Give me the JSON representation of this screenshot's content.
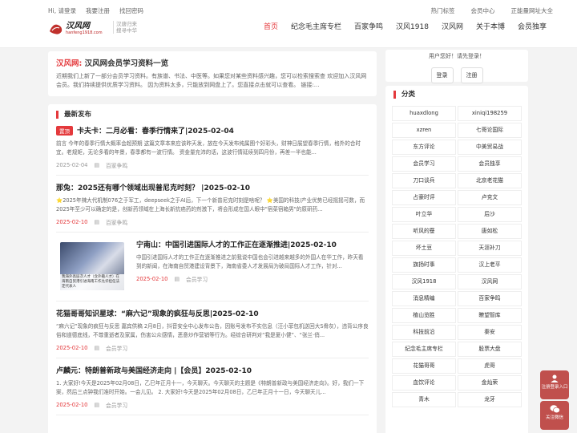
{
  "topbar": {
    "left": [
      "Hi, 请登录",
      "我要注册",
      "找回密码"
    ],
    "right": [
      "热门标签",
      "会员中心",
      "正能量网址大全"
    ]
  },
  "logo": {
    "text1": "汉风网",
    "text2": "hanfeng1918.com",
    "slogan1": "汉唐归来",
    "slogan2": "搜寻中华"
  },
  "nav": [
    {
      "label": "首页",
      "active": true
    },
    {
      "label": "纪念毛主席专栏"
    },
    {
      "label": "百家争鸣"
    },
    {
      "label": "汉风1918"
    },
    {
      "label": "汉风网"
    },
    {
      "label": "关于本博"
    },
    {
      "label": "会员独享"
    }
  ],
  "intro": {
    "site": "汉风网:",
    "title": "汉风网会员学习资料一览",
    "text": "近期我们上新了一部分会员学习资料。有族谱、书法、中医等。如果您对某些资料感兴趣，您可以检索搜索查 欢迎加入汉风网会员。我们持续提供优质学习资料。 因为资料太多，只能放到网盘上了。您直接点击就可以查看。 链接:..."
  },
  "latest": {
    "title": "最新发布",
    "articles": [
      {
        "tag": "置顶",
        "title": "卡夫卡：二月必看：春季行情来了|2025-02-04",
        "excerpt": "前言 今年的春季行情大概率会超预期 这篇文章本来应该昨天发，放在今天发布纯属图个好彩头，财神日展望春季行情，格外的合时宜。老规矩，无论多看的年景，春季都有一波行情。 资金量充沛的话，这波行情延续到四月份，再差一半也能...",
        "date": "2025-02-04",
        "category": "百家争鸣"
      },
      {
        "title": "那兔：2025还有哪个领域出现普尼克时刻？ |2025-02-10",
        "excerpt": "⭐2025年辣大代机制076之于军工，deepseek之于AI后，下一个新普尼克时刻是啥呢？ ⭐美国的科技/产业优势已经摇摇可数，而2025年至少可以确定的是，创新药领域在上海长新抗癌药的剂激下，将会形成在国人眼中\"宿菜宿箱男\"的原研药...",
        "date": "2025-02-10",
        "category": "百家争鸣"
      },
      {
        "title": "宁南山：中国引进国际人才的工作正在逐渐推进|2025-02-10",
        "excerpt": "中国引进国际人才的工作正在逐渐推进之前我说中国也会引进越来越多的外国人在华工作，昨天看到的新闻，在海南自贸港建设背景下，海南省委人才发展局为破局国际人才工作，针对...",
        "date": "2025-02-10",
        "category": "会员学习",
        "thumb_caption": "我海外高层次人才（含外籍人才）在海南自贸港引进海南工作允许担任法定代表人"
      },
      {
        "title": "花猫哥哥知识星球：“麻六记”现象的疯狂与反思|2025-02-10",
        "excerpt": "“麻六记”现象的疯狂与反思 嘉宾供稿 2月8日，抖音安全中心发布公告，因账号发布不实信息（汪小菲包机送回大S骨灰），违背公序良俗和道德底线，不尊重逝者及家属，伤害公众感情，恶意炒作营销等行为。经综合研判对“我是夏小健”、“张兰·俏...",
        "date": "2025-02-10",
        "category": "会员学习"
      },
      {
        "title": "卢麟元：特朗普新政与美国经济走向 |【会员】2025-02-10",
        "excerpt": "1. 大家好!今天是2025年02月08日，乙巳年正月十一，今天聊天。今天聊天的主题是《特朗普新政与美国经济走向》。好，我们一下案，然后三点钟我们准时开始。一会儿见。 2. 大家好!今天是2025年02月08日，乙巳年正月十一日，今天聊天儿...",
        "date": "2025-02-10",
        "category": "会员学习"
      }
    ]
  },
  "login": {
    "message": "用户您好！请先登录！",
    "login": "登录",
    "register": "注册"
  },
  "categories": {
    "title": "分类",
    "items": [
      "huaxdlong",
      "xiniqi198259",
      "xzren",
      "七哥论国际",
      "东方评论",
      "中美贸易战",
      "会员学习",
      "会员独享",
      "刀口谈兵",
      "北京老花猫",
      "占豪时评",
      "卢克文",
      "叶立华",
      "后沙",
      "听风的蚕",
      "唐如松",
      "坏土豆",
      "天涯补刀",
      "旗扬时事",
      "汉上老平",
      "汉风1918",
      "汉风网",
      "消息精编",
      "百家争鸣",
      "植山览胜",
      "瞭望智库",
      "科技前沿",
      "秦安",
      "纪念毛主席专栏",
      "股票大盘",
      "花猫哥哥",
      "虎哥",
      "血饮评论",
      "金灿荣",
      "青木",
      "龙牙"
    ]
  },
  "float": {
    "register": "注册登录入口",
    "follow": "关注微信"
  },
  "colors": {
    "accent": "#e4393c",
    "float": "#c0504d"
  }
}
